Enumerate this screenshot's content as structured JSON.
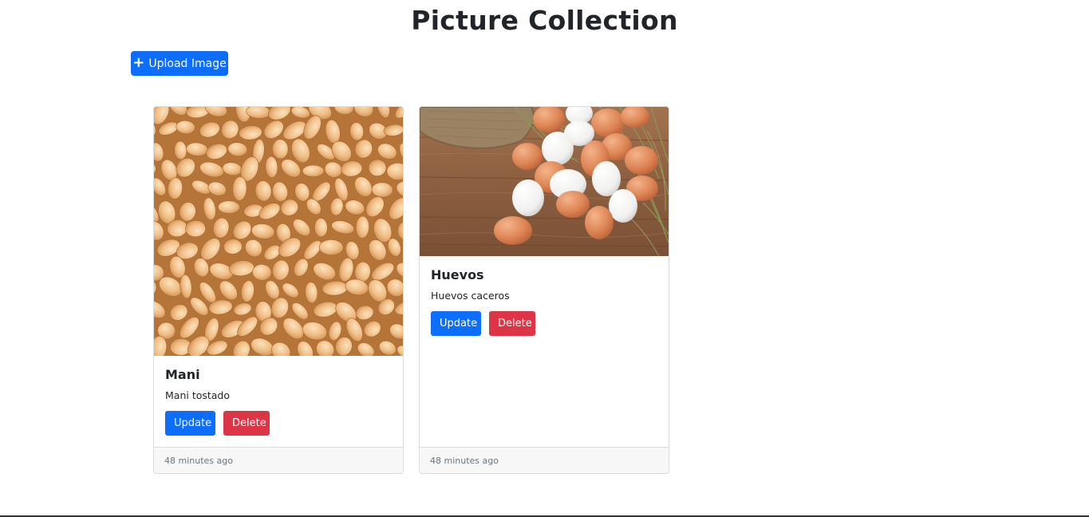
{
  "page": {
    "title": "Picture Collection"
  },
  "toolbar": {
    "upload_label": "Upload Image",
    "upload_icon": "plus-icon"
  },
  "colors": {
    "primary": "#0d6efd",
    "danger": "#dc3545",
    "footer_bg": "#f7f7f7"
  },
  "cards": [
    {
      "title": "Mani",
      "text": "Mani tostado",
      "image": "roasted-peanuts-photo",
      "update_label": "Update",
      "delete_label": "Delete",
      "footer": "48 minutes ago"
    },
    {
      "title": "Huevos",
      "text": "Huevos caceros",
      "image": "eggs-on-wood-photo",
      "update_label": "Update",
      "delete_label": "Delete",
      "footer": "48 minutes ago"
    }
  ]
}
